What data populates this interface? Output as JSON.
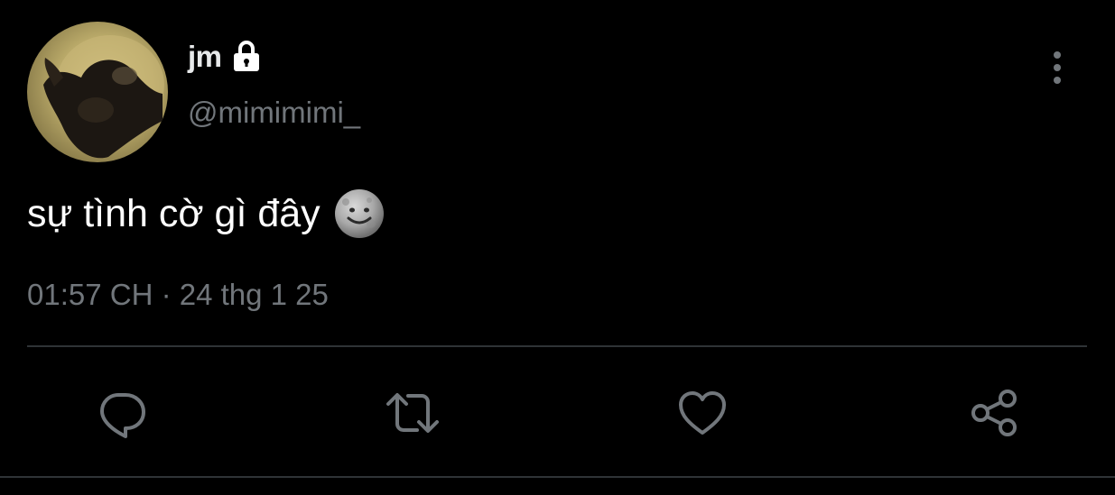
{
  "tweet": {
    "author": {
      "display_name": "jm",
      "handle": "@mimimimi_",
      "protected_icon": "lock-icon",
      "avatar": "profile-photo"
    },
    "text": "sự tình cờ gì đây",
    "emoji": "smiling-moon-face",
    "timestamp": "01:57 CH · 24 thg 1 25"
  },
  "menu_icon": "more-vertical-icon",
  "actions": [
    {
      "name": "reply",
      "icon": "reply-icon"
    },
    {
      "name": "retweet",
      "icon": "retweet-icon"
    },
    {
      "name": "like",
      "icon": "heart-icon"
    },
    {
      "name": "share",
      "icon": "share-icon"
    }
  ],
  "colors": {
    "background": "#000000",
    "primary_text": "#e7e9ea",
    "secondary_text": "#71767b",
    "divider": "#2f3336"
  }
}
